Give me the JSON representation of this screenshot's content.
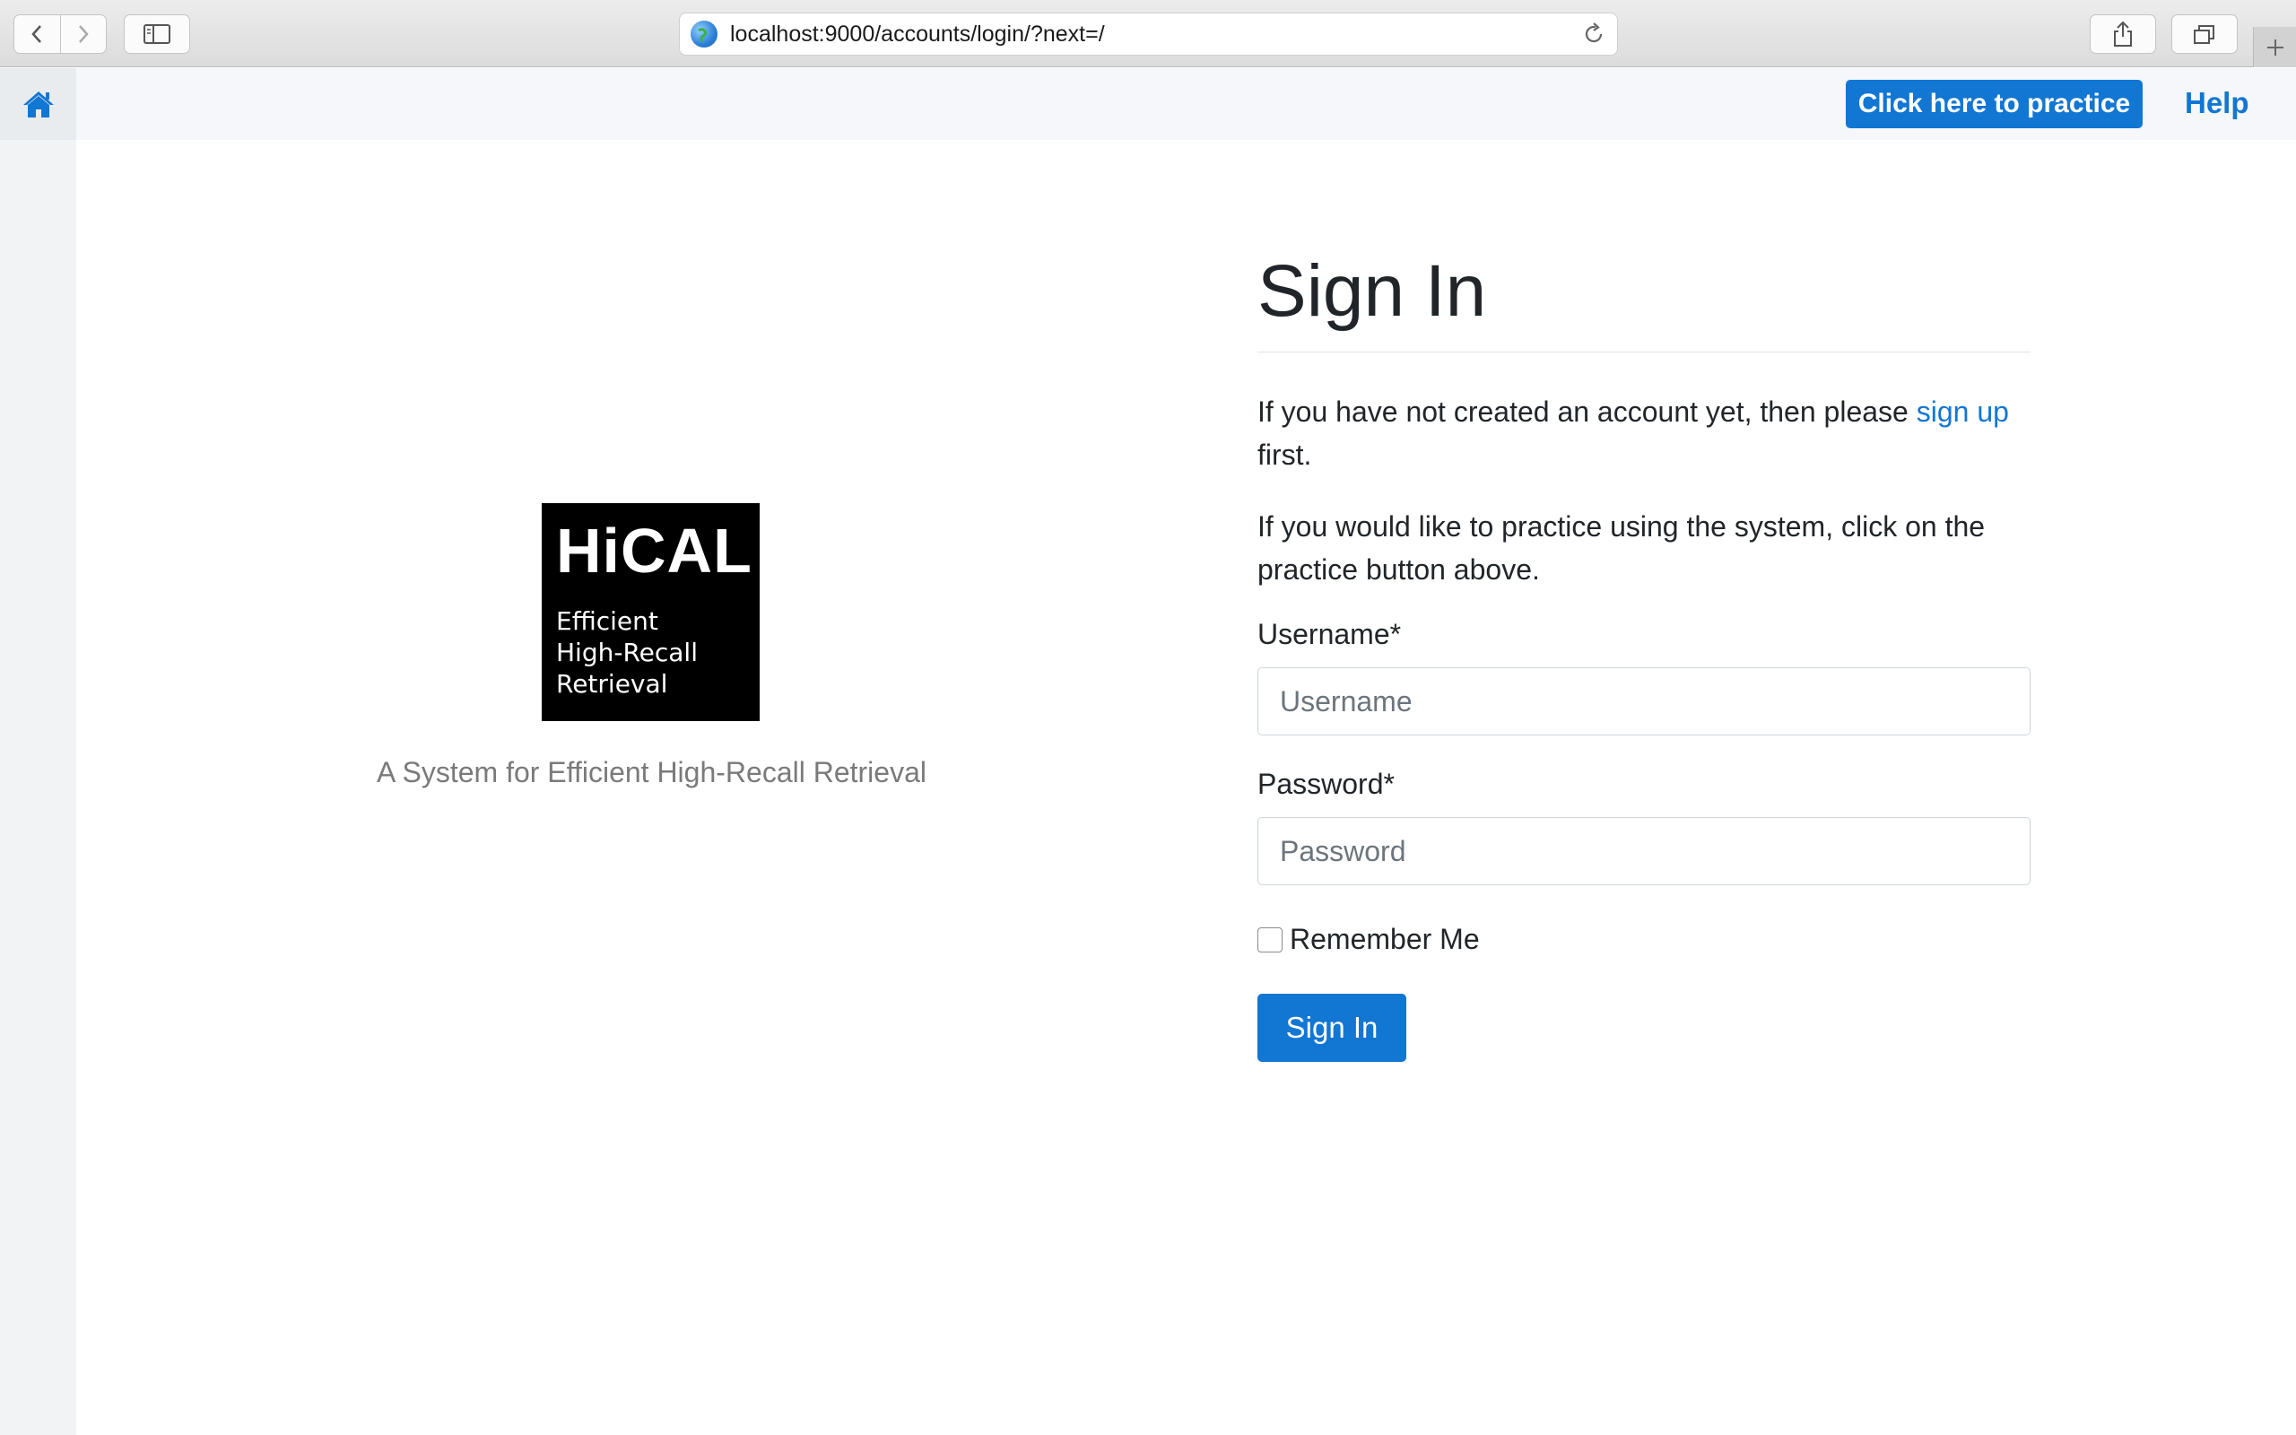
{
  "browser": {
    "url": "localhost:9000/accounts/login/?next=/",
    "icons": [
      "back-icon",
      "forward-icon",
      "sidebar-icon",
      "globe-icon",
      "reload-icon",
      "share-icon",
      "tabs-icon",
      "plus-icon"
    ]
  },
  "nav": {
    "home_icon": "home-icon",
    "practice_label": "Click here to practice",
    "help_label": "Help"
  },
  "logo": {
    "brand": "HiCAL",
    "tag_lines": [
      "Efficient",
      "High-Recall",
      "Retrieval"
    ],
    "caption": "A System for Efficient High-Recall Retrieval"
  },
  "form": {
    "title": "Sign In",
    "intro_before_link": "If you have not created an account yet, then please ",
    "signup_link": "sign up",
    "intro_after_link": " first.",
    "practice_text": "If you would like to practice using the system, click on the practice button above.",
    "username_label": "Username*",
    "username_placeholder": "Username",
    "password_label": "Password*",
    "password_placeholder": "Password",
    "remember_label": "Remember Me",
    "submit_label": "Sign In"
  },
  "colors": {
    "primary": "#1276d3",
    "sidebar": "#f1f3f5",
    "topbar": "#f5f7fa"
  }
}
